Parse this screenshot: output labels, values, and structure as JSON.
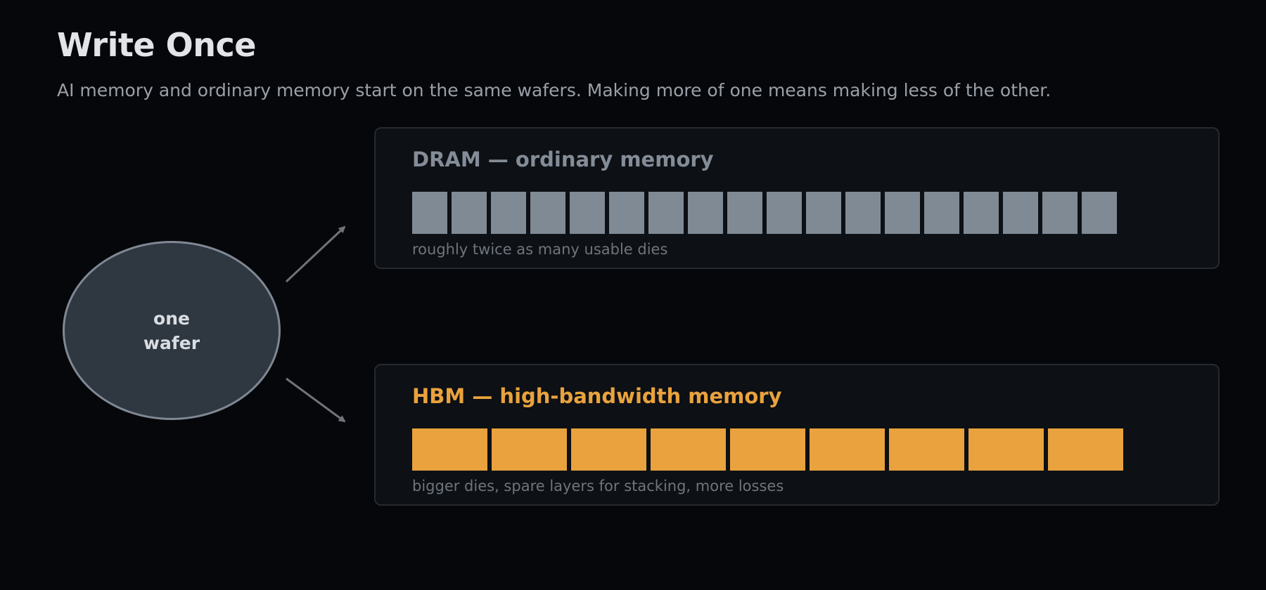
{
  "title": "Write Once",
  "subtitle": "AI memory and ordinary memory start on the same wafers. Making more of one means making less of the other.",
  "wafer": {
    "label_line1": "one",
    "label_line2": "wafer"
  },
  "dram": {
    "title": "DRAM — ordinary memory",
    "die_count": 18,
    "caption": "roughly twice as many usable dies"
  },
  "hbm": {
    "title": "HBM — high-bandwidth memory",
    "die_count": 9,
    "caption": "bigger dies, spare layers for stacking, more losses"
  },
  "colors": {
    "background": "#06070a",
    "dram_accent": "#838c97",
    "dram_die": "#808a95",
    "hbm_accent": "#e9a23d",
    "wafer_fill": "#2f3741",
    "wafer_stroke": "#7f8893",
    "arrow": "#6e737a"
  }
}
